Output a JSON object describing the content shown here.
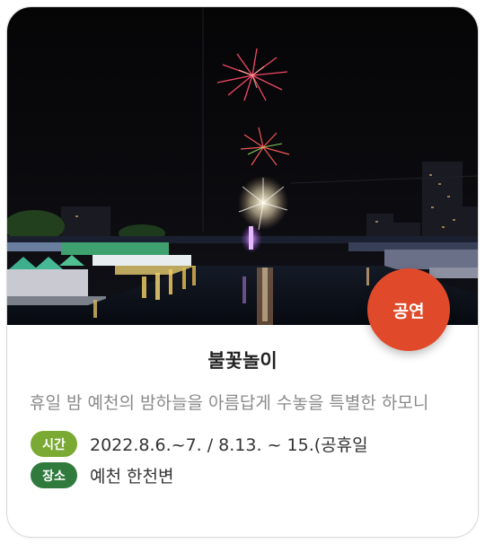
{
  "event": {
    "category_badge": "공연",
    "title": "불꽃놀이",
    "description": "휴일 밤 예천의 밤하늘을 아름답게 수놓을 특별한 하모니",
    "time_label": "시간",
    "time_value": "2022.8.6.~7. / 8.13. ~ 15.(공휴일",
    "place_label": "장소",
    "place_value": "예천 한천변"
  },
  "colors": {
    "badge": "#e04a2a",
    "time_pill": "#7aaa33",
    "place_pill": "#2f7a3c"
  }
}
